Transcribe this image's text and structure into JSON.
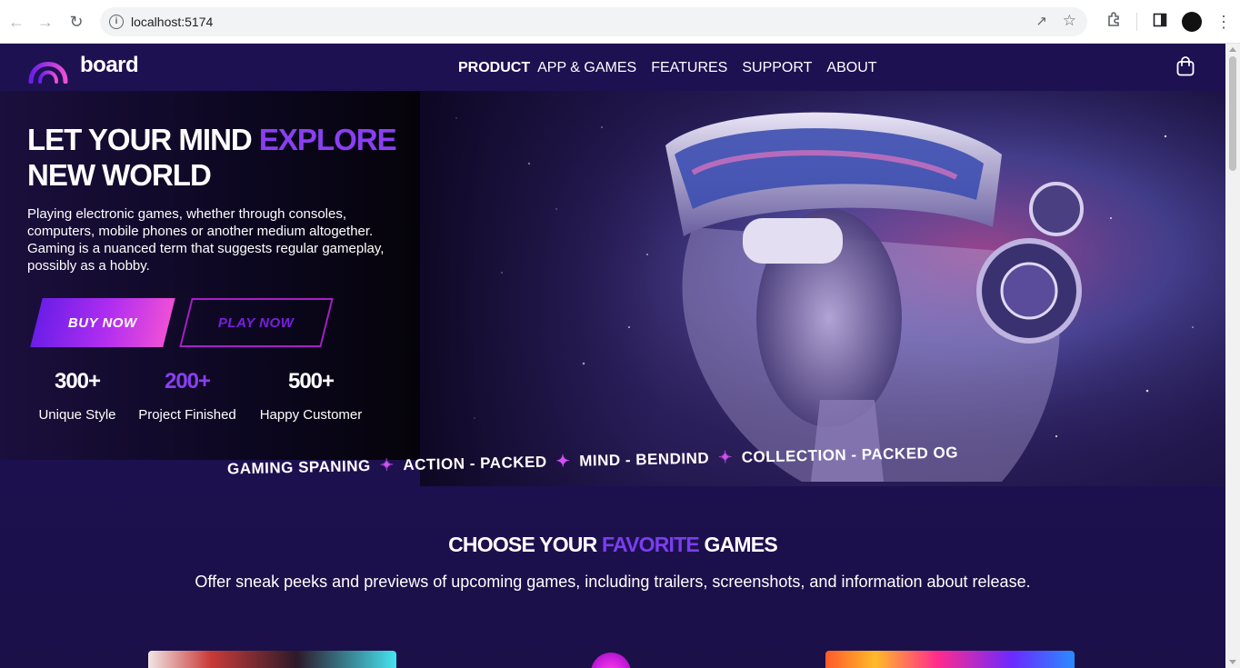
{
  "browser": {
    "url": "localhost:5174"
  },
  "header": {
    "brand": "board",
    "nav": [
      "PRODUCT",
      "APP & GAMES",
      "FEATURES",
      "SUPPORT",
      "ABOUT"
    ]
  },
  "hero": {
    "title_part1": "LET YOUR MIND ",
    "title_accent": "EXPLORE",
    "title_part2": "NEW WORLD",
    "description": "Playing electronic games, whether through consoles, computers, mobile phones or another medium altogether. Gaming is a nuanced term that suggests regular gameplay, possibly as a hobby.",
    "buy_label": "BUY NOW",
    "play_label": "PLAY NOW",
    "stats": [
      {
        "value": "300+",
        "label": "Unique Style"
      },
      {
        "value": "200+",
        "label": "Project Finished"
      },
      {
        "value": "500+",
        "label": "Happy Customer"
      }
    ]
  },
  "marquee": {
    "items": [
      "GAMING SPANING",
      "ACTION - PACKED",
      "MIND - BENDIND",
      "COLLECTION - PACKED OG"
    ]
  },
  "games_section": {
    "title_part1": "CHOOSE YOUR ",
    "title_accent": "FAVORITE",
    "title_part2": " GAMES",
    "subtitle": "Offer sneak peeks and previews of upcoming games, including trailers, screenshots, and information about release."
  },
  "colors": {
    "accent": "#8a3ff2",
    "page_bg": "#1b1048",
    "button_gradient_start": "#6b1ee8",
    "button_gradient_end": "#ee4fd6"
  }
}
